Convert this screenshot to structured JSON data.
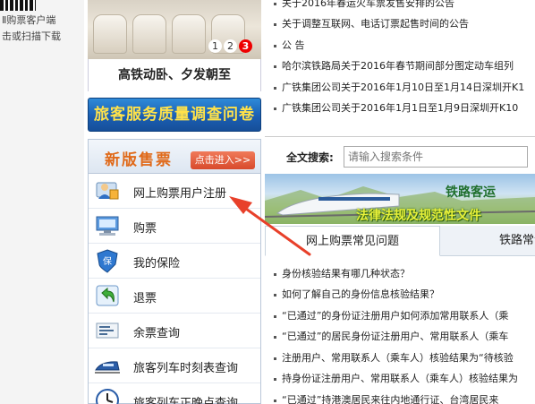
{
  "left_strip": {
    "line1": "Ⅱ购票客户端",
    "line2": "击或扫描下载"
  },
  "banner": {
    "pages": [
      "1",
      "2",
      "3"
    ],
    "active_page": "3",
    "caption": "高铁动卧、夕发朝至"
  },
  "survey_button": "旅客服务质量调查问卷",
  "ticket_panel": {
    "title": "新版售票",
    "enter_label": "点击进入>>",
    "items": [
      {
        "label": "网上购票用户注册",
        "icon": "user-register-icon"
      },
      {
        "label": "购票",
        "icon": "computer-icon"
      },
      {
        "label": "我的保险",
        "icon": "insurance-shield-icon"
      },
      {
        "label": "退票",
        "icon": "refund-arrow-icon"
      },
      {
        "label": "余票查询",
        "icon": "ticket-search-icon"
      },
      {
        "label": "旅客列车时刻表查询",
        "icon": "train-icon"
      },
      {
        "label": "旅客列车正晚点查询",
        "icon": "clock-icon"
      }
    ]
  },
  "news": [
    "关于2016年春运火车票发售安排的公告",
    "关于调整互联网、电话订票起售时间的公告",
    "公 告",
    "哈尔滨铁路局关于2016年春节期间部分图定动车组列",
    "广铁集团公司关于2016年1月10日至1月14日深圳开K1",
    "广铁集团公司关于2016年1月1日至1月9日深圳开K10"
  ],
  "search": {
    "label": "全文搜索:",
    "placeholder": "请输入搜索条件"
  },
  "law_banner": {
    "title1": "铁路客运",
    "title2": "法律法规及规范性文件"
  },
  "tabs": [
    "网上购票常见问题",
    "铁路常识"
  ],
  "faq": [
    "身份核验结果有哪几种状态？",
    "如何了解自己的身份信息核验结果？",
    "“已通过”的身份证注册用户如何添加常用联系人（乘",
    "“已通过”的居民身份证注册用户、常用联系人（乘车",
    "注册用户、常用联系人（乘车人）核验结果为“待核验",
    "持身份证注册用户、常用联系人（乘车人）核验结果为",
    "“已通过”持港澳居民来往内地通行证、台湾居民来"
  ],
  "colors": {
    "accent_red": "#e8402a",
    "survey_blue": "#1b5fb3",
    "survey_text": "#ffe24a",
    "ticket_title": "#e06a1a"
  }
}
